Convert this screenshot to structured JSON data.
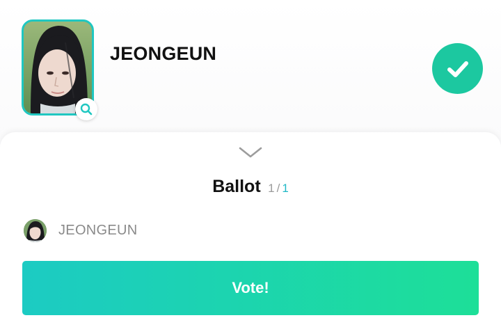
{
  "candidate": {
    "name": "JEONGEUN",
    "photo_icon": "portrait-photo",
    "zoom_icon": "search-icon",
    "selected_icon": "check-icon",
    "accent_color": "#1fc7c1",
    "selected_color": "#1cc8a0"
  },
  "sheet": {
    "collapse_icon": "chevron-down-icon",
    "title": "Ballot",
    "count_current": "1",
    "count_separator": "/",
    "count_total": "1",
    "items": [
      {
        "name": "JEONGEUN",
        "avatar_icon": "avatar"
      }
    ],
    "vote_label": "Vote!",
    "vote_gradient": [
      "#1ccbc3",
      "#1ddf98"
    ]
  }
}
